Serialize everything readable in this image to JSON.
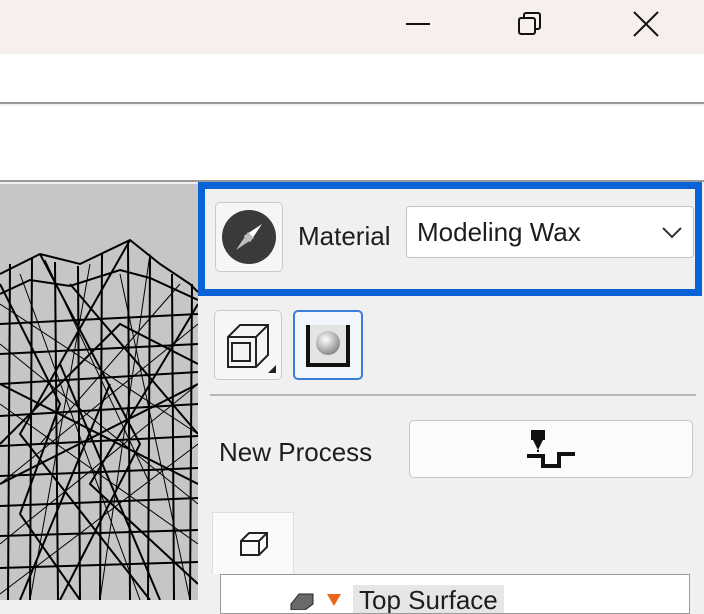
{
  "window": {
    "controls": [
      "minimize",
      "restore",
      "close"
    ]
  },
  "material": {
    "label": "Material",
    "selected": "Modeling Wax",
    "icon": "compass-icon"
  },
  "view_buttons": [
    "stock-box-icon",
    "material-preview-icon"
  ],
  "process": {
    "label": "New Process",
    "icon": "toolpath-step-icon"
  },
  "tree": {
    "tab_icon": "cube-icon",
    "first_item": "Top Surface"
  },
  "colors": {
    "highlight": "#0a63d6",
    "viewport_bg": "#c6c6c6",
    "tree_marker": "#e8661d"
  }
}
